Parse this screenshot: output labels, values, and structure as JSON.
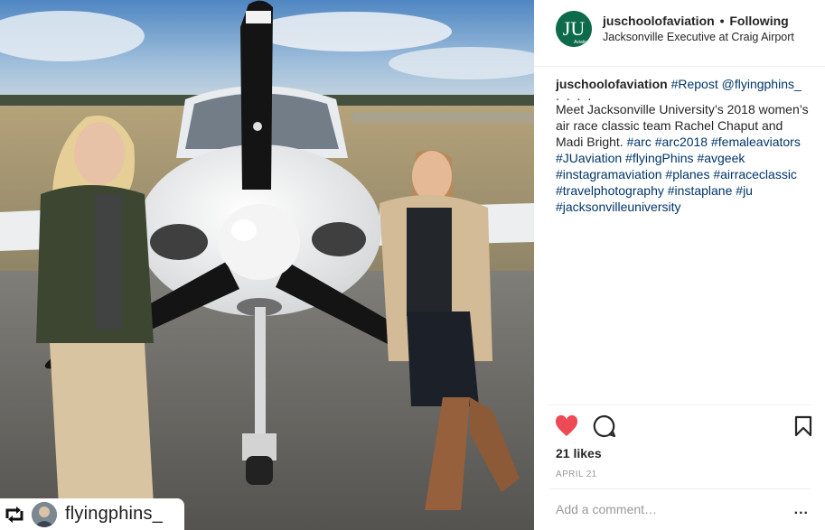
{
  "post": {
    "username": "juschoolofaviation",
    "separator": "•",
    "follow_status": "Following",
    "location": "Jacksonville Executive at Craig Airport",
    "avatar_text": "JU",
    "avatar_subtext": "Aviation"
  },
  "caption": {
    "username": "juschoolofaviation",
    "dots": ". . . .",
    "line1_tags": [
      "#Repost",
      "@flyingphins_"
    ],
    "body": "Meet Jacksonville University’s 2018 women’s air race classic team Rachel Chaput and Madi Bright.",
    "tags": [
      "#arc",
      "#arc2018",
      "#femaleaviators",
      "#JUaviation",
      "#flyingPhins",
      "#avgeek",
      "#instagramaviation",
      "#planes",
      "#airraceclassic",
      "#travelphotography",
      "#instaplane",
      "#ju",
      "#jacksonvilleuniversity"
    ]
  },
  "actions": {
    "like_icon": "heart-filled-icon",
    "comment_icon": "comment-icon",
    "save_icon": "bookmark-icon",
    "liked": true
  },
  "likes_text": "21 likes",
  "date_text": "APRIL 21",
  "comment": {
    "placeholder": "Add a comment…",
    "more_label": "..."
  },
  "repost_tag": {
    "icon": "repost-icon",
    "username": "flyingphins_"
  },
  "colors": {
    "heart": "#ed4956",
    "link": "#003569",
    "muted": "#999999",
    "divider": "#efefef"
  }
}
